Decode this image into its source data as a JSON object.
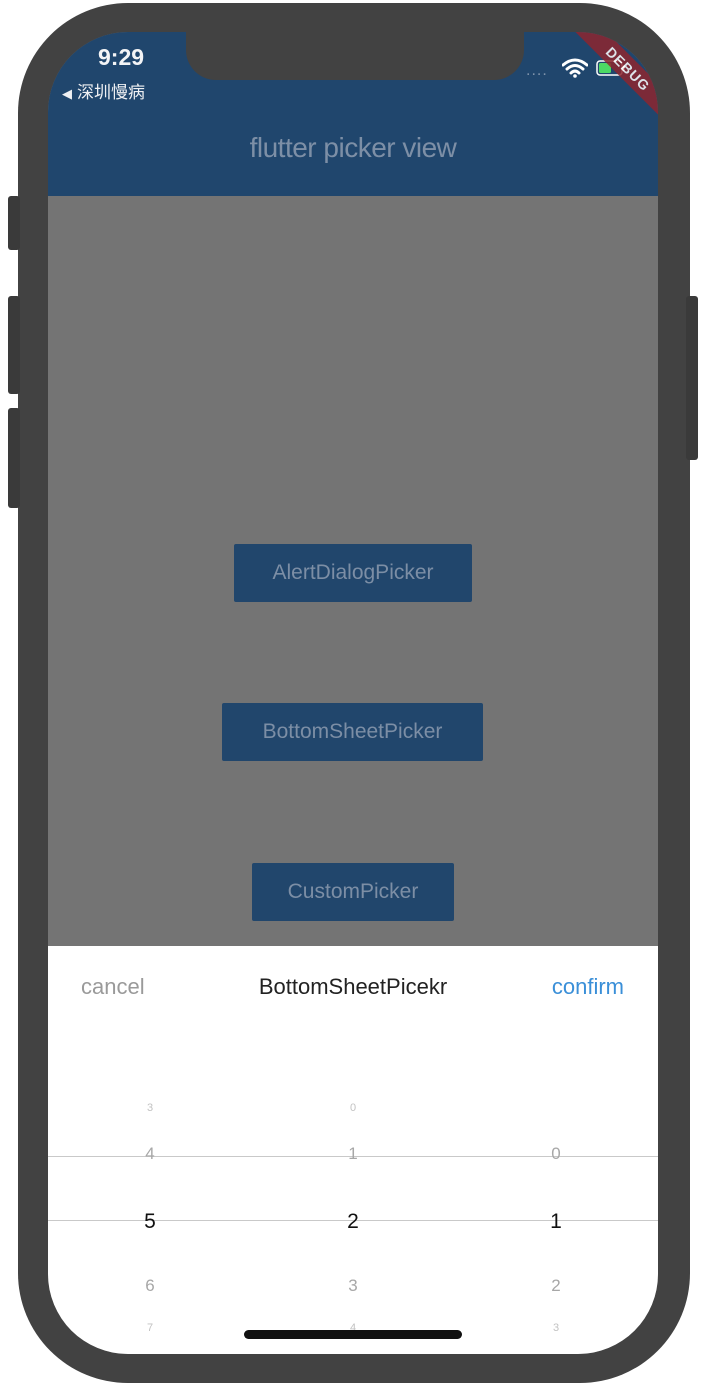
{
  "status_bar": {
    "time": "9:29",
    "back_app": "深圳慢病",
    "signal": "....",
    "debug_label": "DEBUG"
  },
  "appbar": {
    "title": "flutter picker view"
  },
  "buttons": {
    "alert_dialog": "AlertDialogPicker",
    "bottom_sheet": "BottomSheetPicker",
    "custom": "CustomPicker"
  },
  "sheet": {
    "cancel": "cancel",
    "title": "BottomSheetPicekr",
    "confirm": "confirm",
    "columns": [
      {
        "items": [
          "3",
          "4",
          "5",
          "6",
          "7"
        ],
        "selected": "5"
      },
      {
        "items": [
          "0",
          "1",
          "2",
          "3",
          "4"
        ],
        "selected": "2"
      },
      {
        "items": [
          "",
          "0",
          "1",
          "2",
          "3"
        ],
        "selected": "1"
      }
    ]
  },
  "colors": {
    "appbar": "#20466d",
    "scrim": "#747474",
    "accent": "#3a8fd8",
    "debug_ribbon": "#8d2630"
  }
}
